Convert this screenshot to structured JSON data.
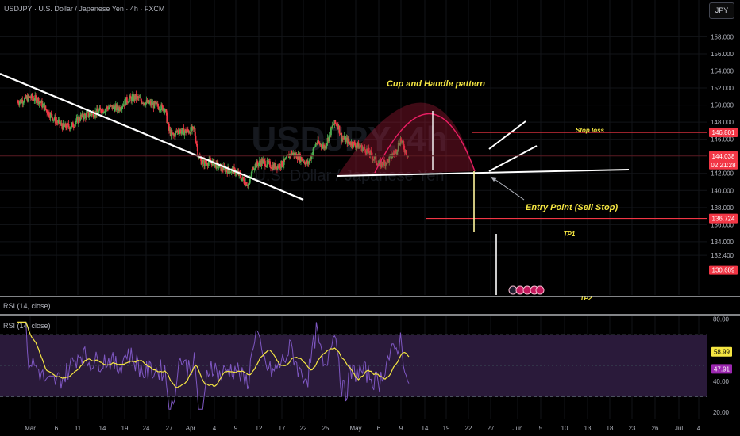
{
  "header": {
    "title": "USDJPY · U.S. Dollar / Japanese Yen · 4h · FXCM",
    "currency_button": "JPY",
    "watermark_symbol": "USDJPY, 4h",
    "watermark_name": "U.S. Dollar / Japanese Yen"
  },
  "rsi_pane": {
    "label_collapsed": "RSI (14, close)",
    "label": "RSI (14, close)"
  },
  "annotations": {
    "pattern_title": "Cup and Handle pattern",
    "stop_loss": "Stop loss",
    "entry": "Entry Point (Sell Stop)",
    "tp1": "TP1",
    "tp2": "TP2"
  },
  "price_badges": [
    {
      "text": "146.801",
      "color": "#f23645",
      "value": 146.801
    },
    {
      "text": "144.038",
      "color": "#f23645",
      "value": 144.038
    },
    {
      "text": "02:21:28",
      "color": "#f23645",
      "value": 144.038,
      "sub": true
    },
    {
      "text": "136.724",
      "color": "#f23645",
      "value": 136.724
    },
    {
      "text": "130.689",
      "color": "#f23645",
      "value": 130.689
    }
  ],
  "rsi_badges": [
    {
      "text": "58.99",
      "color": "#f5e642",
      "value": 58.99
    },
    {
      "text": "47.91",
      "color": "#9c27b0",
      "value": 47.91
    }
  ],
  "colors": {
    "up": "#22ab94",
    "up_bright": "#4caf50",
    "down": "#f23645",
    "rsi_line": "#7e57c2",
    "rsi_ma": "#f5e642",
    "rsi_band": "#2a1a3a",
    "annotation": "#f5e642",
    "trend": "#ffffff",
    "level": "#f23645"
  },
  "chart_data": {
    "type": "candlestick",
    "symbol": "USDJPY",
    "timeframe": "4h",
    "exchange": "FXCM",
    "x_labels": [
      "Mar",
      "6",
      "11",
      "14",
      "19",
      "24",
      "27",
      "Apr",
      "4",
      "9",
      "12",
      "17",
      "22",
      "25",
      "May",
      "6",
      "9",
      "14",
      "19",
      "22",
      "27",
      "Jun",
      "5",
      "10",
      "13",
      "18",
      "23",
      "26",
      "Jul",
      "4"
    ],
    "y_ticks": [
      "158.000",
      "156.000",
      "154.000",
      "152.000",
      "150.000",
      "148.000",
      "146.000",
      "142.000",
      "140.000",
      "138.000",
      "136.000",
      "134.000",
      "132.400"
    ],
    "ylim": [
      130.689,
      158.0
    ],
    "current_price": 144.038,
    "close_path": [
      {
        "date": "Feb 26",
        "price": 150.4
      },
      {
        "date": "Mar 1",
        "price": 150.9
      },
      {
        "date": "Mar 3",
        "price": 150.6
      },
      {
        "date": "Mar 5",
        "price": 149.3
      },
      {
        "date": "Mar 7",
        "price": 148.2
      },
      {
        "date": "Mar 9",
        "price": 147.4
      },
      {
        "date": "Mar 11",
        "price": 147.6
      },
      {
        "date": "Mar 13",
        "price": 148.6
      },
      {
        "date": "Mar 15",
        "price": 148.9
      },
      {
        "date": "Mar 17",
        "price": 149.2
      },
      {
        "date": "Mar 20",
        "price": 149.8
      },
      {
        "date": "Mar 22",
        "price": 149.6
      },
      {
        "date": "Mar 24",
        "price": 150.6
      },
      {
        "date": "Mar 26",
        "price": 150.9
      },
      {
        "date": "Mar 28",
        "price": 150.4
      },
      {
        "date": "Mar 31",
        "price": 149.9
      },
      {
        "date": "Apr 2",
        "price": 149.6
      },
      {
        "date": "Apr 3",
        "price": 147.0
      },
      {
        "date": "Apr 4",
        "price": 146.4
      },
      {
        "date": "Apr 5",
        "price": 147.0
      },
      {
        "date": "Apr 7",
        "price": 146.9
      },
      {
        "date": "Apr 9",
        "price": 147.1
      },
      {
        "date": "Apr 10",
        "price": 144.0
      },
      {
        "date": "Apr 11",
        "price": 143.2
      },
      {
        "date": "Apr 13",
        "price": 143.4
      },
      {
        "date": "Apr 15",
        "price": 142.7
      },
      {
        "date": "Apr 17",
        "price": 142.4
      },
      {
        "date": "Apr 19",
        "price": 142.2
      },
      {
        "date": "Apr 21",
        "price": 141.0
      },
      {
        "date": "Apr 22",
        "price": 140.7
      },
      {
        "date": "Apr 23",
        "price": 142.8
      },
      {
        "date": "Apr 25",
        "price": 143.4
      },
      {
        "date": "Apr 28",
        "price": 142.8
      },
      {
        "date": "Apr 30",
        "price": 143.1
      },
      {
        "date": "May 2",
        "price": 144.4
      },
      {
        "date": "May 4",
        "price": 143.9
      },
      {
        "date": "May 6",
        "price": 143.1
      },
      {
        "date": "May 8",
        "price": 145.6
      },
      {
        "date": "May 10",
        "price": 145.1
      },
      {
        "date": "May 12",
        "price": 147.7
      },
      {
        "date": "May 13",
        "price": 147.9
      },
      {
        "date": "May 14",
        "price": 146.2
      },
      {
        "date": "May 16",
        "price": 145.6
      },
      {
        "date": "May 18",
        "price": 145.2
      },
      {
        "date": "May 20",
        "price": 144.7
      },
      {
        "date": "May 22",
        "price": 143.6
      },
      {
        "date": "May 23",
        "price": 143.0
      },
      {
        "date": "May 25",
        "price": 143.5
      },
      {
        "date": "May 27",
        "price": 144.7
      },
      {
        "date": "May 28",
        "price": 146.0
      },
      {
        "date": "May 29",
        "price": 144.8
      },
      {
        "date": "May 30",
        "price": 144.0
      }
    ],
    "rsi": {
      "period": 14,
      "ylim": [
        20,
        80
      ],
      "y_ticks": [
        "80.00",
        "60.00",
        "40.00",
        "20.00"
      ],
      "upper_band": 70,
      "lower_band": 30,
      "last_rsi": 47.91,
      "last_ma": 58.99
    }
  }
}
